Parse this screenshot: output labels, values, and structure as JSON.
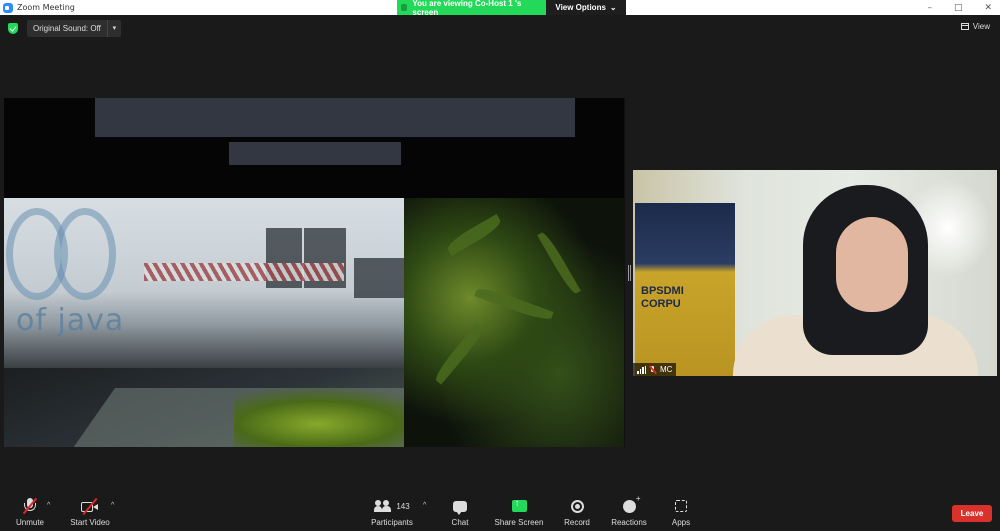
{
  "window": {
    "title": "Zoom Meeting",
    "controls": [
      "–",
      "□",
      "✕"
    ]
  },
  "banner": {
    "viewing_text": "You are viewing Co-Host 1 's screen",
    "view_options_label": "View Options",
    "view_options_caret": "⌄"
  },
  "topbar": {
    "original_sound_label": "Original Sound: Off",
    "original_sound_caret": "▾",
    "view_label": "View"
  },
  "shared_screen": {
    "text": "of java"
  },
  "participant_video": {
    "name": "MC",
    "banner_text_1": "BPSDMI",
    "banner_text_2": "CORPU"
  },
  "toolbar": {
    "unmute_label": "Unmute",
    "start_video_label": "Start Video",
    "participants_label": "Participants",
    "participants_count": "143",
    "chat_label": "Chat",
    "share_screen_label": "Share Screen",
    "record_label": "Record",
    "reactions_label": "Reactions",
    "apps_label": "Apps",
    "leave_label": "Leave",
    "caret": "^"
  },
  "colors": {
    "green": "#23d959",
    "leave_red": "#d9322d",
    "background": "#1a1a1a"
  }
}
